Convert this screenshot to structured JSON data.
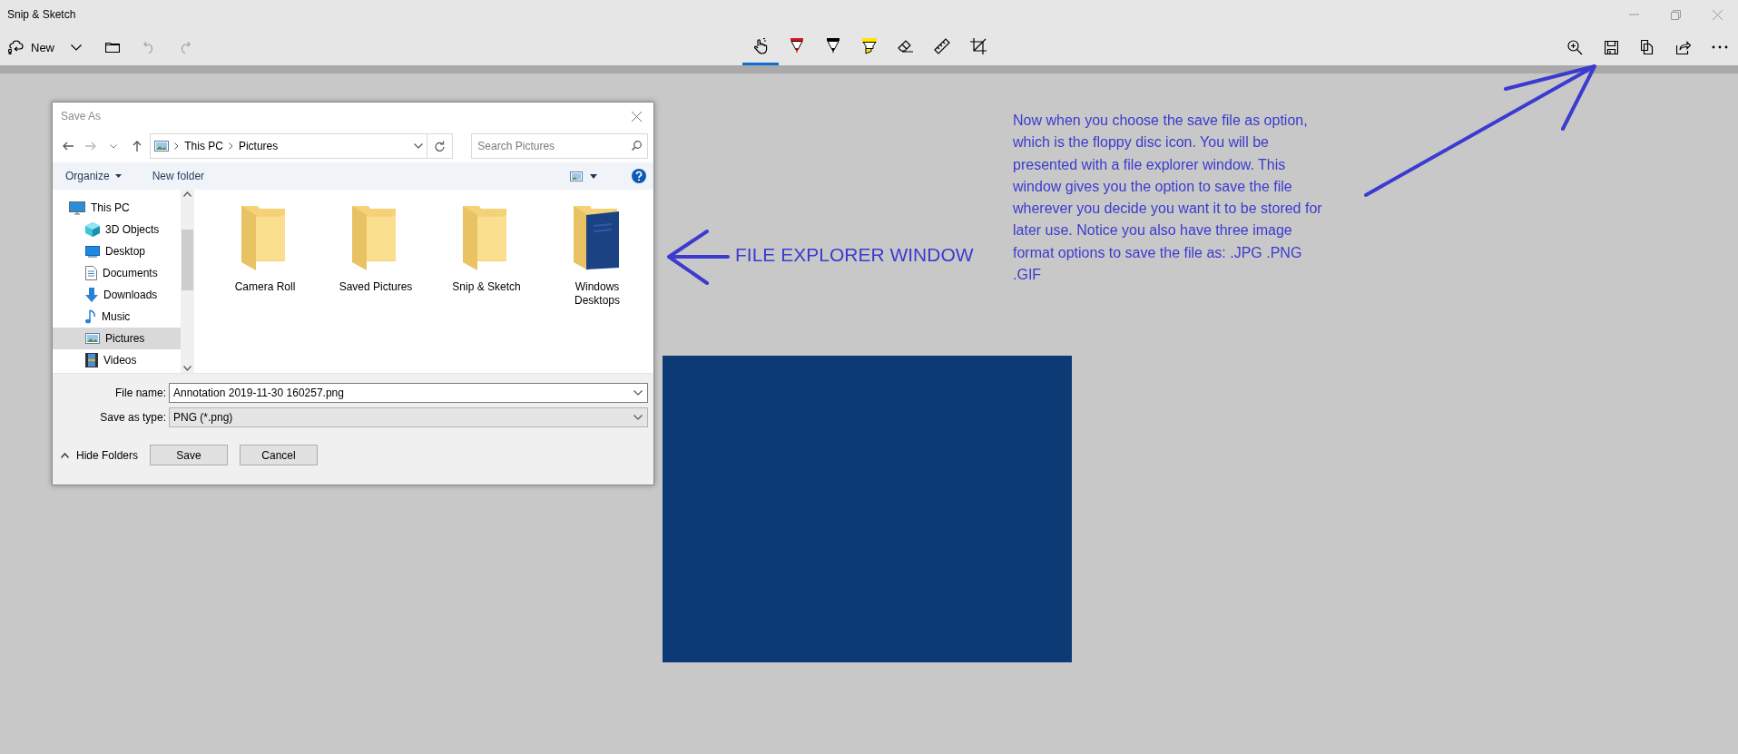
{
  "window": {
    "title": "Snip & Sketch",
    "controls": [
      {
        "kind": "minimize"
      },
      {
        "kind": "restore"
      },
      {
        "kind": "close"
      }
    ]
  },
  "toolbar": {
    "left": [
      {
        "kind": "new",
        "label": "New",
        "disabled": false
      },
      {
        "kind": "dropdown",
        "disabled": false
      },
      {
        "kind": "open",
        "disabled": false
      },
      {
        "kind": "undo",
        "disabled": true
      },
      {
        "kind": "redo",
        "disabled": true
      }
    ],
    "tools": [
      {
        "kind": "touch",
        "selected": true
      },
      {
        "kind": "ballpoint",
        "selected": false
      },
      {
        "kind": "pencil",
        "selected": false
      },
      {
        "kind": "highlighter",
        "selected": false
      },
      {
        "kind": "eraser",
        "selected": false
      },
      {
        "kind": "ruler",
        "selected": false
      },
      {
        "kind": "crop",
        "selected": false
      }
    ],
    "right": [
      {
        "kind": "zoom"
      },
      {
        "kind": "save"
      },
      {
        "kind": "copy"
      },
      {
        "kind": "share"
      },
      {
        "kind": "more"
      }
    ]
  },
  "canvas": {
    "dialog": {
      "title": "Save As",
      "address": [
        "This PC",
        "Pictures"
      ],
      "search_placeholder": "Search Pictures",
      "commands": [
        {
          "label": "Organize",
          "dropdown": true
        },
        {
          "label": "New folder",
          "dropdown": false
        }
      ],
      "tree": [
        {
          "label": "This PC",
          "kind": "pc",
          "selected": false,
          "children": [
            {
              "label": "3D Objects",
              "kind": "cube",
              "selected": false
            },
            {
              "label": "Desktop",
              "kind": "desktop",
              "selected": false
            },
            {
              "label": "Documents",
              "kind": "document",
              "selected": false
            },
            {
              "label": "Downloads",
              "kind": "download",
              "selected": false
            },
            {
              "label": "Music",
              "kind": "music",
              "selected": false
            },
            {
              "label": "Pictures",
              "kind": "pictures",
              "selected": true
            },
            {
              "label": "Videos",
              "kind": "videos",
              "selected": false
            }
          ]
        }
      ],
      "folders": [
        {
          "label": "Camera Roll",
          "kind": "plain"
        },
        {
          "label": "Saved Pictures",
          "kind": "plain"
        },
        {
          "label": "Snip & Sketch",
          "kind": "plain"
        },
        {
          "label": "Windows Desktops",
          "kind": "cover"
        }
      ],
      "file_name_label": "File name:",
      "file_name": "Annotation 2019-11-30 160257.png",
      "type_label": "Save as type:",
      "save_as_type": "PNG (*.png)",
      "hide_folders": "Hide Folders",
      "buttons": [
        "Save",
        "Cancel"
      ]
    },
    "callout": "FILE EXPLORER WINDOW",
    "note": "Now when you choose the save file as option, which is the floppy disc icon. You will be presented with a file explorer window. This window gives you the option to save the file wherever you decide you want it to be stored for later use. Notice you also have three image format options to save the file as: .JPG .PNG .GIF"
  }
}
